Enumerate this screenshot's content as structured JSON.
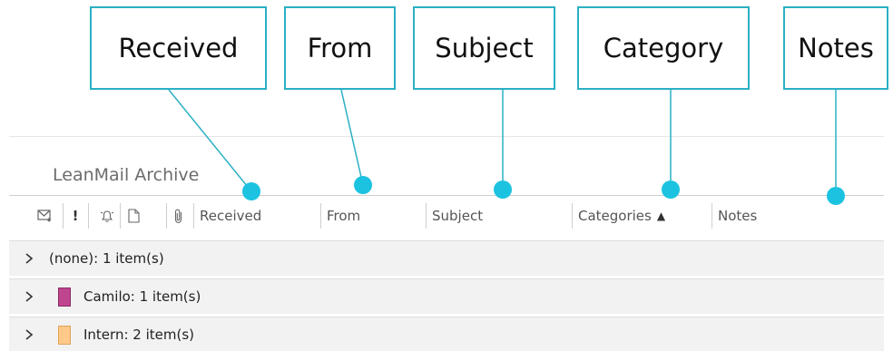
{
  "callouts": {
    "received": "Received",
    "from": "From",
    "subject": "Subject",
    "category": "Category",
    "notes": "Notes"
  },
  "folder": {
    "title": "LeanMail Archive"
  },
  "columns": {
    "icon_names": [
      "envelope-icon",
      "importance-icon",
      "reminder-bell-icon",
      "document-icon",
      "attachment-icon"
    ],
    "importance_glyph": "!",
    "received": "Received",
    "from": "From",
    "subject": "Subject",
    "categories": "Categories",
    "categories_sort": "▲",
    "notes": "Notes"
  },
  "groups": [
    {
      "label": "(none): 1 item(s)",
      "color": null
    },
    {
      "label": "Camilo: 1 item(s)",
      "color": "#c0458f",
      "border": "#8a2c66"
    },
    {
      "label": "Intern: 2 item(s)",
      "color": "#ffc98a",
      "border": "#e0a35a"
    }
  ],
  "colors": {
    "accent": "#2bb0c4",
    "dot": "#1cc3e0"
  }
}
